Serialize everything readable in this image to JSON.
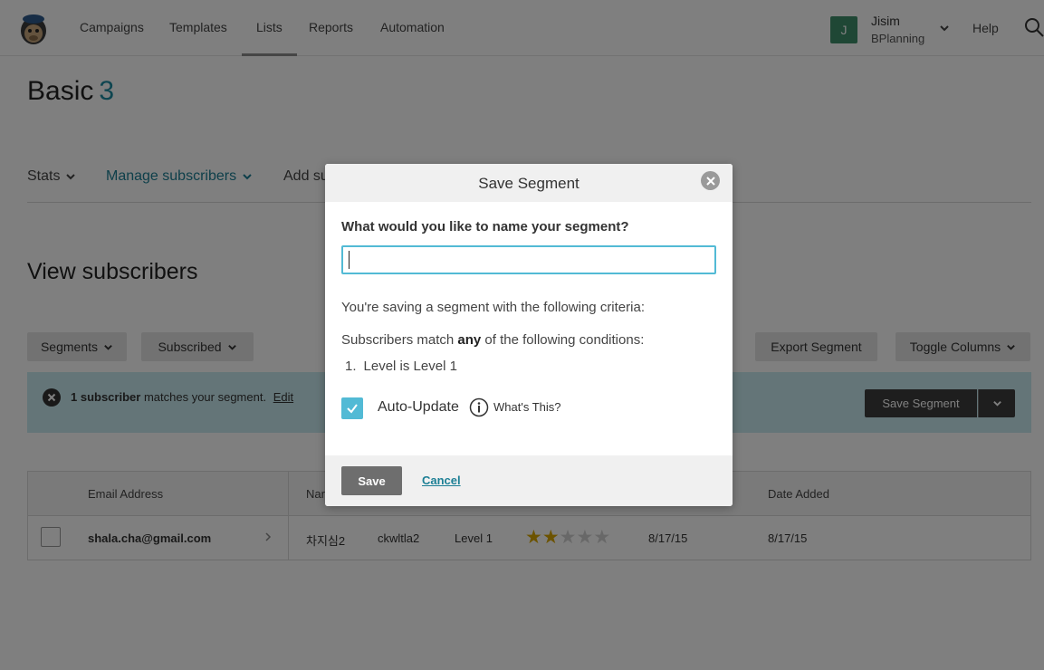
{
  "nav": {
    "items": [
      "Campaigns",
      "Templates",
      "Lists",
      "Reports",
      "Automation"
    ],
    "user": {
      "initial": "J",
      "name": "Jisim",
      "org": "BPlanning"
    },
    "help": "Help"
  },
  "page": {
    "list_title": "Basic",
    "list_count": "3",
    "subnav": {
      "stats": "Stats",
      "manage": "Manage subscribers",
      "add": "Add su"
    },
    "section_title": "View subscribers"
  },
  "toolbar": {
    "segments": "Segments",
    "subscribed": "Subscribed",
    "export": "Export Segment",
    "toggle": "Toggle Columns"
  },
  "banner": {
    "count": "1 subscriber",
    "text": "matches your segment.",
    "edit": "Edit",
    "save_segment": "Save Segment"
  },
  "table": {
    "headers": {
      "email": "Email Address",
      "name": "Nar",
      "date_added": "Date Added"
    },
    "row": {
      "email": "shala.cha@gmail.com",
      "name": "차지심2",
      "last_name": "ckwltla2",
      "level": "Level 1",
      "rating": 2,
      "rating_max": 5,
      "date1": "8/17/15",
      "date2": "8/17/15"
    }
  },
  "modal": {
    "title": "Save Segment",
    "question": "What would you like to name your segment?",
    "input_value": "",
    "criteria_intro": "You're saving a segment with the following criteria:",
    "match_prefix": "Subscribers match",
    "match_word": "any",
    "match_suffix": "of the following conditions:",
    "condition_num": "1.",
    "condition": "Level is Level 1",
    "auto_update": "Auto-Update",
    "auto_update_checked": true,
    "whats_this": "What's This?",
    "save": "Save",
    "cancel": "Cancel"
  },
  "colors": {
    "accent": "#52bad5",
    "teal_text": "#1c7f95",
    "banner": "#c8eaf1",
    "star": "#d8a600"
  }
}
